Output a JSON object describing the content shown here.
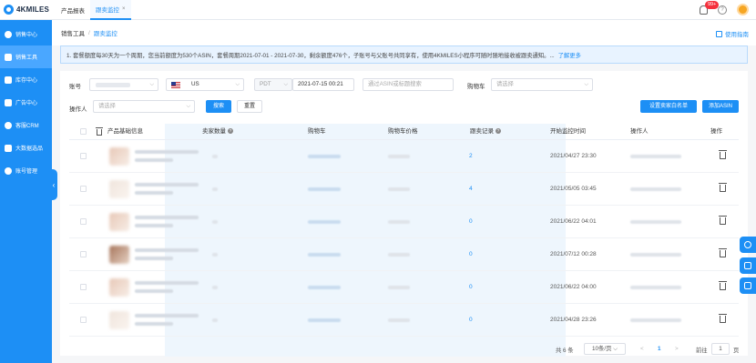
{
  "brand": {
    "name": "4KMILES"
  },
  "sidebar": {
    "items": [
      {
        "label": "销售中心",
        "icon": "pie-chart-icon"
      },
      {
        "label": "销售工具",
        "icon": "toolbox-icon"
      },
      {
        "label": "库存中心",
        "icon": "home-icon"
      },
      {
        "label": "广告中心",
        "icon": "ad-icon"
      },
      {
        "label": "客服CRM",
        "icon": "headset-icon"
      },
      {
        "label": "大数据选品",
        "icon": "database-icon"
      },
      {
        "label": "账号管理",
        "icon": "user-icon"
      }
    ],
    "active_index": 1
  },
  "topbar": {
    "tabs": [
      {
        "label": "产品报表"
      },
      {
        "label": "跟卖监控"
      }
    ],
    "tab_close": "×",
    "badge": "99+",
    "help": "?"
  },
  "breadcrumb": {
    "parent": "销售工具",
    "sep": "/",
    "current": "跟卖监控",
    "guide": "使用指南"
  },
  "notice": {
    "text": "1. 套餐额度每30天为一个周期，您当前额度为530个ASIN，套餐周期2021-07-01 - 2021-07-30，剩余额度476个，子账号与父账号共同享有，使用4KMILES小程序可随时随地接收被跟卖通知。...",
    "more": "了解更多"
  },
  "filters": {
    "account_label": "账号",
    "marketplace": "US",
    "timezone": "PDT",
    "datetime": "2021-07-15 00:21",
    "asin_placeholder": "通过ASIN或标题搜索",
    "buybox_label": "购物车",
    "buybox_placeholder": "请选择",
    "operator_label": "操作人",
    "operator_placeholder": "请选择",
    "search_btn": "搜索",
    "reset_btn": "重置",
    "whitelist_btn": "设置卖家白名单",
    "add_asin_btn": "添加ASIN"
  },
  "table": {
    "headers": [
      "产品基础信息",
      "卖家数量",
      "购物车",
      "购物车价格",
      "跟卖记录",
      "开始监控时间",
      "操作人",
      "操作"
    ],
    "rows": [
      {
        "records": "2",
        "start_time": "2021/04/27 23:30"
      },
      {
        "records": "4",
        "start_time": "2021/05/05 03:45"
      },
      {
        "records": "0",
        "start_time": "2021/06/22 04:01"
      },
      {
        "records": "0",
        "start_time": "2021/07/12 00:28"
      },
      {
        "records": "0",
        "start_time": "2021/06/22 04:00"
      },
      {
        "records": "0",
        "start_time": "2021/04/28 23:26"
      }
    ]
  },
  "pagination": {
    "total": "共 6 条",
    "page_size": "10条/页",
    "prev": "<",
    "current": "1",
    "next": ">",
    "goto_label": "前往",
    "goto_value": "1",
    "page_suffix": "页"
  },
  "colors": {
    "primary": "#1d8ff5",
    "sidebar": "#1d8ff5",
    "notice_bg": "#e8f3ff",
    "badge": "#f5313d"
  }
}
